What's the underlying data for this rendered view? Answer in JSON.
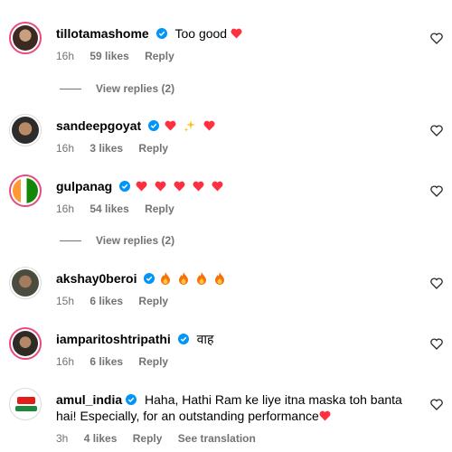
{
  "comments": [
    {
      "username": "tillotamashome",
      "verified": true,
      "text": "Too good",
      "emojis": [
        "red-heart"
      ],
      "time": "16h",
      "likes": "59 likes",
      "reply": "Reply",
      "view_replies": "View replies (2)"
    },
    {
      "username": "sandeepgoyat",
      "verified": true,
      "text": "",
      "emojis": [
        "red-heart",
        "sparkles",
        "red-heart"
      ],
      "time": "16h",
      "likes": "3 likes",
      "reply": "Reply"
    },
    {
      "username": "gulpanag",
      "verified": true,
      "text": "",
      "emojis": [
        "red-heart",
        "red-heart",
        "red-heart",
        "red-heart",
        "red-heart"
      ],
      "time": "16h",
      "likes": "54 likes",
      "reply": "Reply",
      "view_replies": "View replies (2)"
    },
    {
      "username": "akshay0beroi",
      "verified": true,
      "text": "",
      "emojis": [
        "fire",
        "fire",
        "fire",
        "fire"
      ],
      "time": "15h",
      "likes": "6 likes",
      "reply": "Reply"
    },
    {
      "username": "iamparitoshtripathi",
      "verified": true,
      "text": "वाह",
      "emojis": [],
      "time": "16h",
      "likes": "6 likes",
      "reply": "Reply"
    },
    {
      "username": "amul_india",
      "verified": true,
      "text": "Haha, Hathi Ram ke liye itna maska toh banta hai! Especially, for an outstanding performance",
      "emojis": [
        "red-heart"
      ],
      "time": "3h",
      "likes": "4 likes",
      "reply": "Reply",
      "see_translation": "See translation"
    }
  ],
  "colors": {
    "verified": "#0095f6",
    "heart": "#ff3040",
    "fire": "#f5730a",
    "meta": "#737373",
    "story_ring": "#e64a7f"
  }
}
